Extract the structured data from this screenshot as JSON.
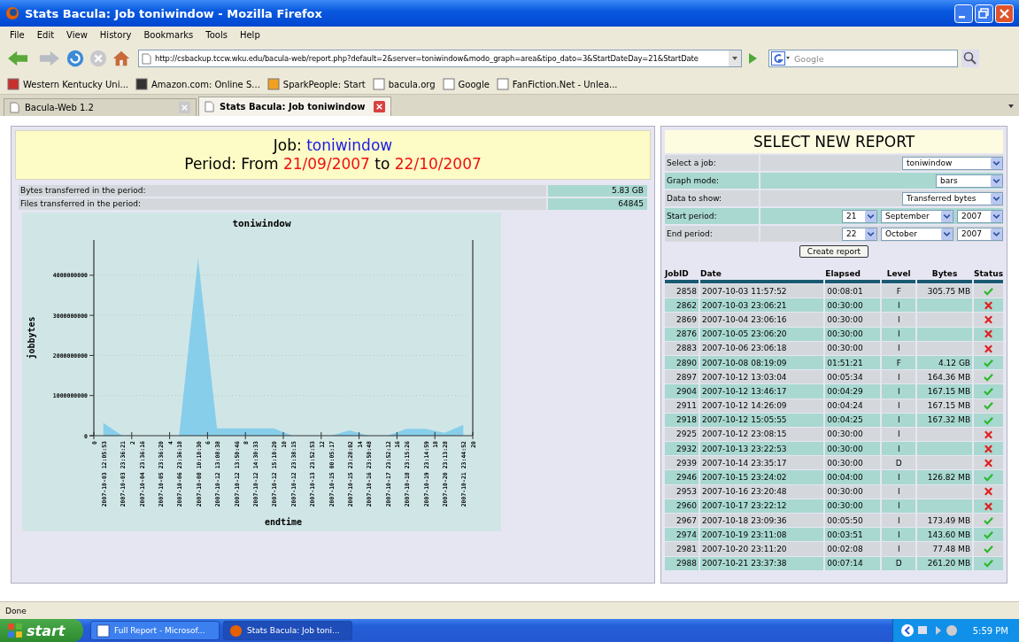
{
  "window": {
    "title": "Stats Bacula: Job toniwindow - Mozilla Firefox"
  },
  "menu": [
    "File",
    "Edit",
    "View",
    "History",
    "Bookmarks",
    "Tools",
    "Help"
  ],
  "address": {
    "value": "http://csbackup.tccw.wku.edu/bacula-web/report.php?default=2&server=toniwindow&modo_graph=area&tipo_dato=3&StartDateDay=21&StartDate"
  },
  "search": {
    "placeholder": "Google"
  },
  "bookmarks": [
    "Western Kentucky Uni...",
    "Amazon.com: Online S...",
    "SparkPeople: Start",
    "bacula.org",
    "Google",
    "FanFiction.Net - Unlea..."
  ],
  "tabs": [
    {
      "label": "Bacula-Web 1.2",
      "selected": false
    },
    {
      "label": "Stats Bacula: Job toniwindow",
      "selected": true
    }
  ],
  "report_header": {
    "job_label": "Job:",
    "job": "toniwindow",
    "period_label": "Period: From",
    "start": "21/09/2007",
    "connector": "to",
    "end": "22/10/2007"
  },
  "stats": [
    {
      "label": "Bytes transferred in the period:",
      "value": "5.83 GB"
    },
    {
      "label": "Files transferred in the period:",
      "value": "64845"
    }
  ],
  "chart": {
    "chart_data": {
      "type": "area",
      "title": "toniwindow",
      "xlabel": "endtime",
      "ylabel": "jobbytes",
      "categories": [
        "2007-10-03 12:05:53",
        "2007-10-03 23:36:21",
        "2007-10-04 23:36:16",
        "2007-10-05 23:36:20",
        "2007-10-06 23:36:18",
        "2007-10-08 10:10:30",
        "2007-10-12 13:08:38",
        "2007-10-12 13:50:46",
        "2007-10-12 14:30:33",
        "2007-10-12 15:10:20",
        "2007-10-12 23:38:15",
        "2007-10-13 23:52:53",
        "2007-10-15 00:05:17",
        "2007-10-15 23:28:02",
        "2007-10-16 23:50:48",
        "2007-10-17 23:52:12",
        "2007-10-18 23:15:26",
        "2007-10-19 23:14:59",
        "2007-10-20 23:13:28",
        "2007-10-21 23:44:52"
      ],
      "series": [
        {
          "color": "#87ceeb",
          "values": [
            320000000,
            0,
            0,
            0,
            0,
            4430000000,
            180000000,
            180000000,
            180000000,
            180000000,
            0,
            0,
            0,
            130000000,
            0,
            0,
            170000000,
            170000000,
            70000000,
            270000000
          ]
        }
      ],
      "ylim": [
        0,
        4880000000
      ],
      "yticks": [
        0,
        1000000000,
        2000000000,
        3000000000,
        4000000000
      ],
      "grid": true
    },
    "x_axis_numbers": [
      "0",
      "2",
      "4",
      "6",
      "8",
      "10",
      "12",
      "14",
      "16",
      "18",
      "20"
    ]
  },
  "form": {
    "title": "SELECT NEW REPORT",
    "rows": [
      {
        "kind": "select",
        "label": "Select a job:",
        "values": [
          "toniwindow"
        ]
      },
      {
        "kind": "select",
        "label": "Graph mode:",
        "values": [
          "bars"
        ]
      },
      {
        "kind": "select",
        "label": "Data to show:",
        "values": [
          "Transferred bytes"
        ]
      },
      {
        "kind": "date",
        "label": "Start period:",
        "values": [
          "21",
          "September",
          "2007"
        ]
      },
      {
        "kind": "date",
        "label": "End period:",
        "values": [
          "22",
          "October",
          "2007"
        ]
      }
    ],
    "button": "Create report"
  },
  "jobs": {
    "columns": [
      "JobID",
      "Date",
      "Elapsed",
      "Level",
      "Bytes",
      "Status"
    ],
    "rows": [
      {
        "id": "2858",
        "date": "2007-10-03 11:57:52",
        "elapsed": "00:08:01",
        "level": "F",
        "bytes": "305.75 MB",
        "succeeded": true
      },
      {
        "id": "2862",
        "date": "2007-10-03 23:06:21",
        "elapsed": "00:30:00",
        "level": "I",
        "succeeded": false
      },
      {
        "id": "2869",
        "date": "2007-10-04 23:06:16",
        "elapsed": "00:30:00",
        "level": "I",
        "succeeded": false
      },
      {
        "id": "2876",
        "date": "2007-10-05 23:06:20",
        "elapsed": "00:30:00",
        "level": "I",
        "succeeded": false
      },
      {
        "id": "2883",
        "date": "2007-10-06 23:06:18",
        "elapsed": "00:30:00",
        "level": "I",
        "succeeded": false
      },
      {
        "id": "2890",
        "date": "2007-10-08 08:19:09",
        "elapsed": "01:51:21",
        "level": "F",
        "bytes": "4.12 GB",
        "succeeded": true
      },
      {
        "id": "2897",
        "date": "2007-10-12 13:03:04",
        "elapsed": "00:05:34",
        "level": "I",
        "bytes": "164.36 MB",
        "succeeded": true
      },
      {
        "id": "2904",
        "date": "2007-10-12 13:46:17",
        "elapsed": "00:04:29",
        "level": "I",
        "bytes": "167.15 MB",
        "succeeded": true
      },
      {
        "id": "2911",
        "date": "2007-10-12 14:26:09",
        "elapsed": "00:04:24",
        "level": "I",
        "bytes": "167.15 MB",
        "succeeded": true
      },
      {
        "id": "2918",
        "date": "2007-10-12 15:05:55",
        "elapsed": "00:04:25",
        "level": "I",
        "bytes": "167.32 MB",
        "succeeded": true
      },
      {
        "id": "2925",
        "date": "2007-10-12 23:08:15",
        "elapsed": "00:30:00",
        "level": "I",
        "succeeded": false
      },
      {
        "id": "2932",
        "date": "2007-10-13 23:22:53",
        "elapsed": "00:30:00",
        "level": "I",
        "succeeded": false
      },
      {
        "id": "2939",
        "date": "2007-10-14 23:35:17",
        "elapsed": "00:30:00",
        "level": "D",
        "succeeded": false
      },
      {
        "id": "2946",
        "date": "2007-10-15 23:24:02",
        "elapsed": "00:04:00",
        "level": "I",
        "bytes": "126.82 MB",
        "succeeded": true
      },
      {
        "id": "2953",
        "date": "2007-10-16 23:20:48",
        "elapsed": "00:30:00",
        "level": "I",
        "succeeded": false
      },
      {
        "id": "2960",
        "date": "2007-10-17 23:22:12",
        "elapsed": "00:30:00",
        "level": "I",
        "succeeded": false
      },
      {
        "id": "2967",
        "date": "2007-10-18 23:09:36",
        "elapsed": "00:05:50",
        "level": "I",
        "bytes": "173.49 MB",
        "succeeded": true
      },
      {
        "id": "2974",
        "date": "2007-10-19 23:11:08",
        "elapsed": "00:03:51",
        "level": "I",
        "bytes": "143.60 MB",
        "succeeded": true
      },
      {
        "id": "2981",
        "date": "2007-10-20 23:11:20",
        "elapsed": "00:02:08",
        "level": "I",
        "bytes": "77.48 MB",
        "succeeded": true
      },
      {
        "id": "2988",
        "date": "2007-10-21 23:37:38",
        "elapsed": "00:07:14",
        "level": "D",
        "bytes": "261.20 MB",
        "succeeded": true
      }
    ]
  },
  "status_bar": "Done",
  "taskbar": {
    "start": "start",
    "tasks": [
      {
        "label": "Full Report - Microsof...",
        "selected": false
      },
      {
        "label": "Stats Bacula: Job toni...",
        "selected": true
      }
    ],
    "clock": "5:59 PM"
  }
}
